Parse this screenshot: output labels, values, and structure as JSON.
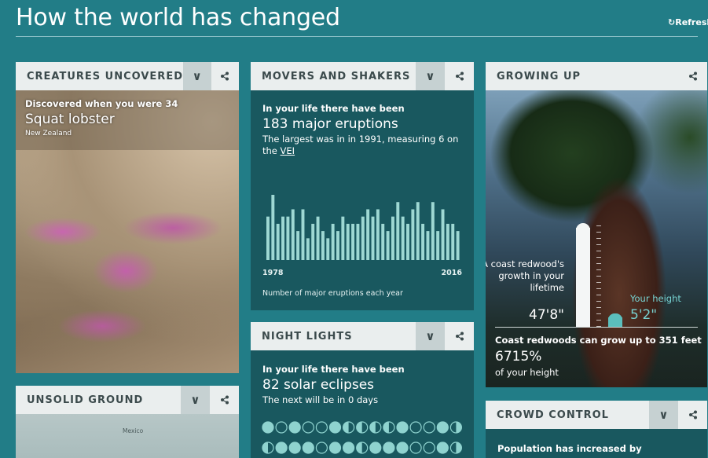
{
  "page": {
    "title": "How the world has changed",
    "refresh_label": "Refresh"
  },
  "creatures": {
    "header": "CREATURES UNCOVERED",
    "discovered": "Discovered when you were 34",
    "species": "Squat lobster",
    "location": "New Zealand"
  },
  "movers": {
    "header": "MOVERS AND SHAKERS",
    "lead": "In your life there have been",
    "headline": "183 major eruptions",
    "detail_prefix": "The largest was in in 1991, measuring 6 on the ",
    "detail_link": "VEI",
    "chart_start": "1978",
    "chart_end": "2016",
    "chart_caption": "Number of major eruptions each year"
  },
  "growing": {
    "header": "GROWING UP",
    "redwood_label": "A coast redwood's growth in your lifetime",
    "redwood_value": "47'8\"",
    "height_label": "Your height",
    "height_value": "5'2\"",
    "max_label": "Coast redwoods can grow up to 351 feet",
    "percent": "6715%",
    "percent_label": "of your height"
  },
  "night": {
    "header": "NIGHT LIGHTS",
    "lead": "In your life there have been",
    "headline": "82 solar eclipses",
    "detail": "The next will be in 0 days",
    "moon_rows": [
      [
        "full",
        "new",
        "full",
        "new",
        "new",
        "full",
        "last",
        "last",
        "last",
        "last",
        "full",
        "new",
        "new",
        "full",
        "first"
      ],
      [
        "last",
        "full",
        "full",
        "full",
        "new",
        "full",
        "full",
        "last",
        "full",
        "full",
        "full",
        "new",
        "new",
        "full",
        "first"
      ]
    ]
  },
  "unsolid": {
    "header": "UNSOLID GROUND",
    "map_label": "Mexico"
  },
  "crowd": {
    "header": "CROWD CONTROL",
    "lead": "Population has increased by"
  },
  "colors": {
    "background": "#227d87",
    "card_dark": "#19585f",
    "bar": "#9ed8d3",
    "accent": "#77d3d2"
  },
  "chart_data": {
    "type": "bar",
    "x": [
      "1978",
      "1979",
      "1980",
      "1981",
      "1982",
      "1983",
      "1984",
      "1985",
      "1986",
      "1987",
      "1988",
      "1989",
      "1990",
      "1991",
      "1992",
      "1993",
      "1994",
      "1995",
      "1996",
      "1997",
      "1998",
      "1999",
      "2000",
      "2001",
      "2002",
      "2003",
      "2004",
      "2005",
      "2006",
      "2007",
      "2008",
      "2009",
      "2010",
      "2011",
      "2012",
      "2013",
      "2014",
      "2015",
      "2016"
    ],
    "values": [
      6,
      9,
      5,
      6,
      6,
      7,
      4,
      7,
      3,
      5,
      6,
      4,
      3,
      5,
      4,
      6,
      5,
      5,
      5,
      6,
      7,
      6,
      7,
      5,
      4,
      6,
      8,
      6,
      5,
      7,
      8,
      5,
      4,
      8,
      4,
      7,
      5,
      5,
      4
    ],
    "xlabel": "",
    "ylabel": "",
    "grid": false
  }
}
